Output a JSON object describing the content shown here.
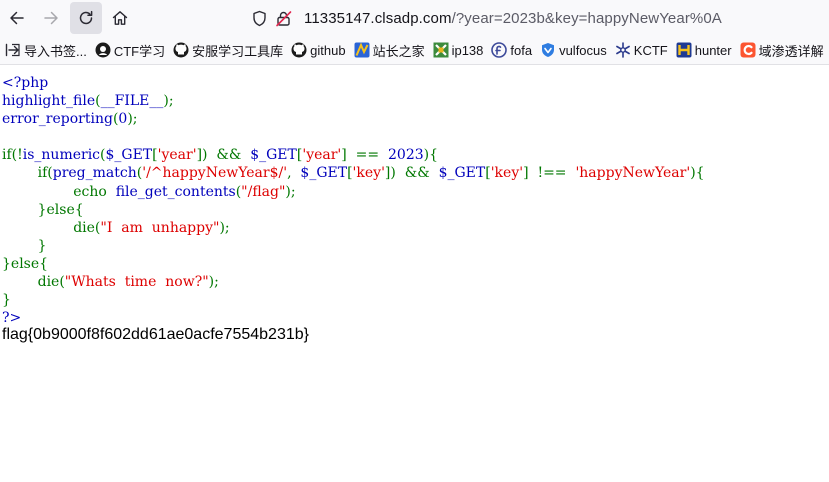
{
  "browser": {
    "url": {
      "host": "11335147.clsadp.com",
      "path": "/?year=2023b&key=happyNewYear%0A"
    }
  },
  "bookmarks": [
    {
      "label": "导入书签...",
      "icon": "import-icon"
    },
    {
      "label": "CTF学习",
      "icon": "ctf-icon"
    },
    {
      "label": "安服学习工具库",
      "icon": "github-icon"
    },
    {
      "label": "github",
      "icon": "github-icon"
    },
    {
      "label": "站长之家",
      "icon": "chinaz-icon"
    },
    {
      "label": "ip138",
      "icon": "ip138-icon"
    },
    {
      "label": "fofa",
      "icon": "fofa-icon"
    },
    {
      "label": "vulfocus",
      "icon": "vulfocus-icon"
    },
    {
      "label": "KCTF",
      "icon": "kctf-icon"
    },
    {
      "label": "hunter",
      "icon": "hunter-icon"
    },
    {
      "label": "域渗透详解",
      "icon": "csdn-icon"
    }
  ],
  "code_lines": [
    [
      {
        "t": "<?php",
        "c": "ph"
      }
    ],
    [
      {
        "t": "highlight_file",
        "c": "ph"
      },
      {
        "t": "(",
        "c": "kw"
      },
      {
        "t": "__FILE__",
        "c": "ph"
      },
      {
        "t": ");",
        "c": "kw"
      }
    ],
    [
      {
        "t": "error_reporting",
        "c": "ph"
      },
      {
        "t": "(",
        "c": "kw"
      },
      {
        "t": "0",
        "c": "ph"
      },
      {
        "t": ");",
        "c": "kw"
      }
    ],
    [],
    [
      {
        "t": "if(!",
        "c": "kw"
      },
      {
        "t": "is_numeric",
        "c": "ph"
      },
      {
        "t": "(",
        "c": "kw"
      },
      {
        "t": "$_GET",
        "c": "ph"
      },
      {
        "t": "[",
        "c": "kw"
      },
      {
        "t": "'year'",
        "c": "st"
      },
      {
        "t": "])  &&  ",
        "c": "kw"
      },
      {
        "t": "$_GET",
        "c": "ph"
      },
      {
        "t": "[",
        "c": "kw"
      },
      {
        "t": "'year'",
        "c": "st"
      },
      {
        "t": "]  ==  ",
        "c": "kw"
      },
      {
        "t": "2023",
        "c": "ph"
      },
      {
        "t": "){",
        "c": "kw"
      }
    ],
    [
      {
        "t": "        if(",
        "c": "kw"
      },
      {
        "t": "preg_match",
        "c": "ph"
      },
      {
        "t": "(",
        "c": "kw"
      },
      {
        "t": "'/^happyNewYear$/'",
        "c": "st"
      },
      {
        "t": ",  ",
        "c": "kw"
      },
      {
        "t": "$_GET",
        "c": "ph"
      },
      {
        "t": "[",
        "c": "kw"
      },
      {
        "t": "'key'",
        "c": "st"
      },
      {
        "t": "])  &&  ",
        "c": "kw"
      },
      {
        "t": "$_GET",
        "c": "ph"
      },
      {
        "t": "[",
        "c": "kw"
      },
      {
        "t": "'key'",
        "c": "st"
      },
      {
        "t": "]  !==  ",
        "c": "kw"
      },
      {
        "t": "'happyNewYear'",
        "c": "st"
      },
      {
        "t": "){",
        "c": "kw"
      }
    ],
    [
      {
        "t": "                echo  ",
        "c": "kw"
      },
      {
        "t": "file_get_contents",
        "c": "ph"
      },
      {
        "t": "(",
        "c": "kw"
      },
      {
        "t": "\"/flag\"",
        "c": "st"
      },
      {
        "t": ");",
        "c": "kw"
      }
    ],
    [
      {
        "t": "        }else{",
        "c": "kw"
      }
    ],
    [
      {
        "t": "                die(",
        "c": "kw"
      },
      {
        "t": "\"I  am  unhappy\"",
        "c": "st"
      },
      {
        "t": ");",
        "c": "kw"
      }
    ],
    [
      {
        "t": "        }",
        "c": "kw"
      }
    ],
    [
      {
        "t": "}else{",
        "c": "kw"
      }
    ],
    [
      {
        "t": "        die(",
        "c": "kw"
      },
      {
        "t": "\"Whats  time  now?\"",
        "c": "st"
      },
      {
        "t": ");",
        "c": "kw"
      }
    ],
    [
      {
        "t": "}",
        "c": "kw"
      }
    ],
    [
      {
        "t": "?>",
        "c": "ph"
      }
    ]
  ],
  "flag_text": "flag{0b9000f8f602dd61ae0acfe7554b231b}"
}
